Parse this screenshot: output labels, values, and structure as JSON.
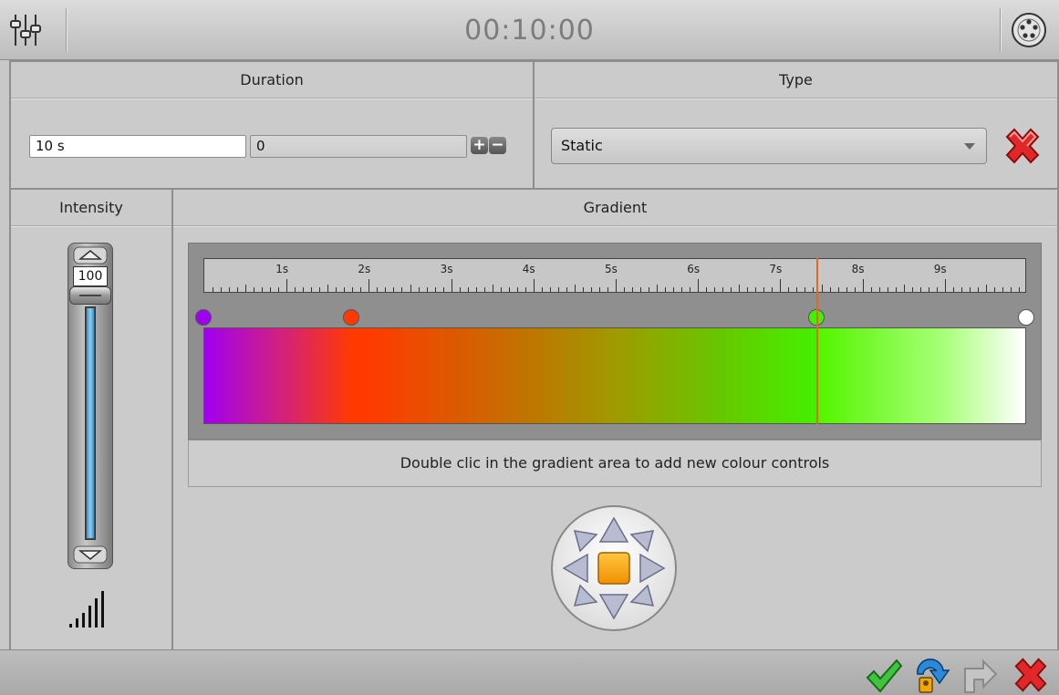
{
  "header": {
    "time": "00:10:00",
    "settings_icon": "sliders-icon",
    "dmx_icon": "dmx-connector-icon"
  },
  "duration": {
    "title": "Duration",
    "seconds_value": "10 s",
    "frames_value": "0",
    "plus_label": "+",
    "minus_label": "−"
  },
  "type": {
    "title": "Type",
    "selected": "Static",
    "delete_icon": "red-x-icon"
  },
  "intensity": {
    "title": "Intensity",
    "value": "100",
    "level": 1.0
  },
  "gradient": {
    "title": "Gradient",
    "ruler_labels": [
      "1s",
      "2s",
      "3s",
      "4s",
      "5s",
      "6s",
      "7s",
      "8s",
      "9s"
    ],
    "duration_seconds": 10,
    "cursor_seconds": 7.45,
    "stops": [
      {
        "pos": 0.0,
        "color": "#a000f0"
      },
      {
        "pos": 0.18,
        "color": "#ff3a00"
      },
      {
        "pos": 0.745,
        "color": "#44f000"
      },
      {
        "pos": 1.0,
        "color": "#ffffff"
      }
    ],
    "hint": "Double clic in the gradient area to add new colour controls"
  },
  "footer": {
    "ok_icon": "checkmark-icon",
    "reset_icon": "reset-icon",
    "redo_icon": "redo-icon",
    "cancel_icon": "cancel-icon"
  },
  "colors": {
    "accent_orange": "#f5a000",
    "slider_fill": "#5fb8e8",
    "cursor": "#e06a20"
  }
}
